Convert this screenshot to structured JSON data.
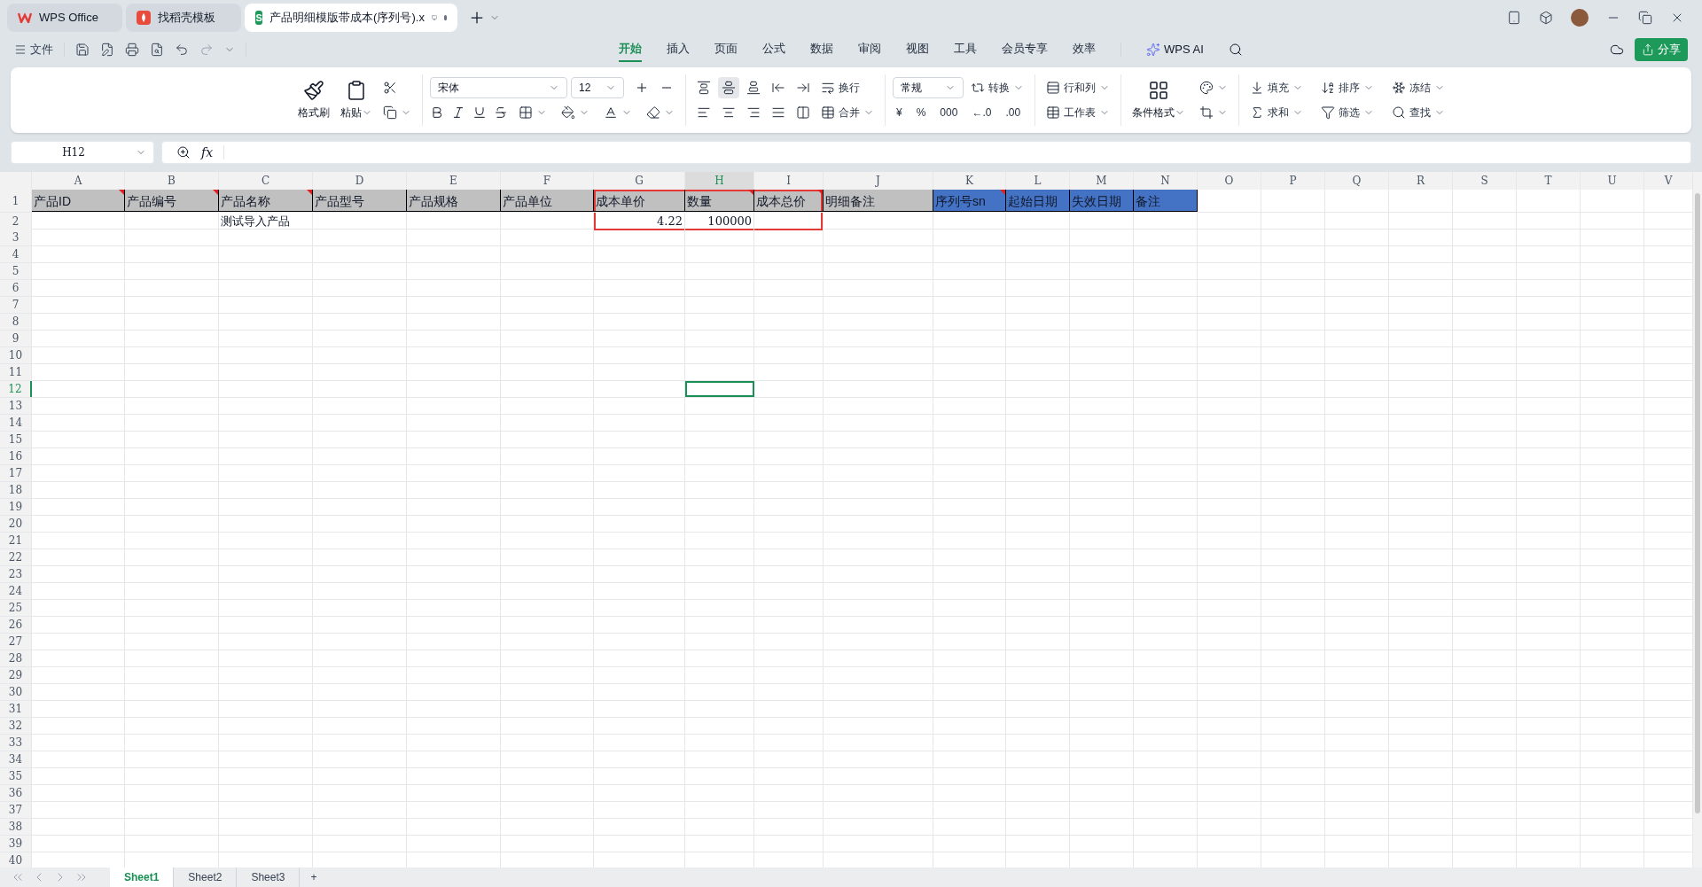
{
  "window_tabs": [
    {
      "kind": "wps",
      "label": "WPS Office",
      "selected": false
    },
    {
      "kind": "template",
      "label": "找稻壳模板",
      "selected": false
    },
    {
      "kind": "sheet",
      "badge": "S",
      "label": "产品明细模版带成本(序列号).x",
      "selected": true
    }
  ],
  "file_menu": "文件",
  "menu_tabs": [
    {
      "label": "开始",
      "selected": true
    },
    {
      "label": "插入",
      "selected": false
    },
    {
      "label": "页面",
      "selected": false
    },
    {
      "label": "公式",
      "selected": false
    },
    {
      "label": "数据",
      "selected": false
    },
    {
      "label": "审阅",
      "selected": false
    },
    {
      "label": "视图",
      "selected": false
    },
    {
      "label": "工具",
      "selected": false
    },
    {
      "label": "会员专享",
      "selected": false
    },
    {
      "label": "效率",
      "selected": false
    }
  ],
  "ai_label": "WPS AI",
  "share_label": "分享",
  "ribbon": {
    "format_painter": "格式刷",
    "paste": "粘贴",
    "font": "宋体",
    "size": "12",
    "wrap": "换行",
    "merge": "合并",
    "number_format": "常规",
    "convert": "转换",
    "currency": "¥",
    "percent": "%",
    "thousands": "000",
    "dec_more": "←.0",
    "dec_less": ".00",
    "rows_cols": "行和列",
    "worksheet": "工作表",
    "conditional": "条件格式",
    "fill": "填充",
    "sort": "排序",
    "freeze": "冻结",
    "sum": "求和",
    "filter": "筛选",
    "find": "查找"
  },
  "align_buttons": [
    {
      "selected": false
    },
    {
      "selected": true
    },
    {
      "selected": false
    },
    {
      "selected": false
    },
    {
      "selected": false
    }
  ],
  "name_box": "H12",
  "formula_label": "fx",
  "columns": [
    {
      "label": "A",
      "selected": false
    },
    {
      "label": "B",
      "selected": false
    },
    {
      "label": "C",
      "selected": false
    },
    {
      "label": "D",
      "selected": false
    },
    {
      "label": "E",
      "selected": false
    },
    {
      "label": "F",
      "selected": false
    },
    {
      "label": "G",
      "selected": false
    },
    {
      "label": "H",
      "selected": true
    },
    {
      "label": "I",
      "selected": false
    },
    {
      "label": "J",
      "selected": false
    },
    {
      "label": "K",
      "selected": false
    },
    {
      "label": "L",
      "selected": false
    },
    {
      "label": "M",
      "selected": false
    },
    {
      "label": "N",
      "selected": false
    },
    {
      "label": "O",
      "selected": false
    },
    {
      "label": "P",
      "selected": false
    },
    {
      "label": "Q",
      "selected": false
    },
    {
      "label": "R",
      "selected": false
    },
    {
      "label": "S",
      "selected": false
    },
    {
      "label": "T",
      "selected": false
    },
    {
      "label": "U",
      "selected": false
    },
    {
      "label": "V",
      "selected": false
    }
  ],
  "rows": [
    {
      "label": "1",
      "selected": false,
      "cells": [
        {
          "kind": "header",
          "text": "产品ID",
          "color": "#c0c0c0",
          "comment": true,
          "highlighted": false
        },
        {
          "kind": "header",
          "text": "产品编号",
          "color": "#c0c0c0",
          "comment": true,
          "highlighted": false
        },
        {
          "kind": "header",
          "text": "产品名称",
          "color": "#c0c0c0",
          "comment": true,
          "highlighted": false
        },
        {
          "kind": "header",
          "text": "产品型号",
          "color": "#c0c0c0",
          "comment": false,
          "highlighted": false
        },
        {
          "kind": "header",
          "text": "产品规格",
          "color": "#c0c0c0",
          "comment": false,
          "highlighted": false
        },
        {
          "kind": "header",
          "text": "产品单位",
          "color": "#c0c0c0",
          "comment": false,
          "highlighted": false
        },
        {
          "kind": "header",
          "text": "成本单价",
          "color": "#c0c0c0",
          "comment": false,
          "highlighted": true
        },
        {
          "kind": "header",
          "text": "数量",
          "color": "#c0c0c0",
          "comment": true,
          "highlighted": true
        },
        {
          "kind": "header",
          "text": "成本总价",
          "color": "#c0c0c0",
          "comment": true,
          "highlighted": true
        },
        {
          "kind": "header",
          "text": "明细备注",
          "color": "#c0c0c0",
          "comment": false,
          "highlighted": false
        },
        {
          "kind": "header",
          "text": "序列号sn",
          "color": "#4472c4",
          "comment": true,
          "highlighted": false
        },
        {
          "kind": "header",
          "text": "起始日期",
          "color": "#4472c4",
          "comment": false,
          "highlighted": false
        },
        {
          "kind": "header",
          "text": "失效日期",
          "color": "#4472c4",
          "comment": false,
          "highlighted": false
        },
        {
          "kind": "header",
          "text": "备注",
          "color": "#4472c4",
          "comment": false,
          "highlighted": false
        }
      ]
    },
    {
      "label": "2",
      "selected": false,
      "cells": [
        {
          "kind": "empty",
          "highlighted": false
        },
        {
          "kind": "empty",
          "highlighted": false
        },
        {
          "kind": "text",
          "text": "测试导入产品",
          "highlighted": false
        },
        {
          "kind": "empty",
          "highlighted": false
        },
        {
          "kind": "empty",
          "highlighted": false
        },
        {
          "kind": "empty",
          "highlighted": false
        },
        {
          "kind": "number",
          "text": "4.22",
          "highlighted": true
        },
        {
          "kind": "number",
          "text": "100000",
          "highlighted": true
        },
        {
          "kind": "empty",
          "highlighted": true
        }
      ]
    },
    {
      "label": "3",
      "selected": false
    },
    {
      "label": "4",
      "selected": false
    },
    {
      "label": "5",
      "selected": false
    },
    {
      "label": "6",
      "selected": false
    },
    {
      "label": "7",
      "selected": false
    },
    {
      "label": "8",
      "selected": false
    },
    {
      "label": "9",
      "selected": false
    },
    {
      "label": "10",
      "selected": false
    },
    {
      "label": "11",
      "selected": false
    },
    {
      "label": "12",
      "selected": true
    },
    {
      "label": "13",
      "selected": false
    },
    {
      "label": "14",
      "selected": false
    },
    {
      "label": "15",
      "selected": false
    },
    {
      "label": "16",
      "selected": false
    },
    {
      "label": "17",
      "selected": false
    },
    {
      "label": "18",
      "selected": false
    },
    {
      "label": "19",
      "selected": false
    },
    {
      "label": "20",
      "selected": false
    },
    {
      "label": "21",
      "selected": false
    },
    {
      "label": "22",
      "selected": false
    },
    {
      "label": "23",
      "selected": false
    },
    {
      "label": "24",
      "selected": false
    },
    {
      "label": "25",
      "selected": false
    },
    {
      "label": "26",
      "selected": false
    },
    {
      "label": "27",
      "selected": false
    },
    {
      "label": "28",
      "selected": false
    },
    {
      "label": "29",
      "selected": false
    },
    {
      "label": "30",
      "selected": false
    },
    {
      "label": "31",
      "selected": false
    },
    {
      "label": "32",
      "selected": false
    },
    {
      "label": "33",
      "selected": false
    },
    {
      "label": "34",
      "selected": false
    },
    {
      "label": "35",
      "selected": false
    },
    {
      "label": "36",
      "selected": false
    },
    {
      "label": "37",
      "selected": false
    },
    {
      "label": "38",
      "selected": false
    },
    {
      "label": "39",
      "selected": false
    },
    {
      "label": "40",
      "selected": false
    }
  ],
  "sheet_tabs": [
    {
      "label": "Sheet1",
      "selected": true
    },
    {
      "label": "Sheet2",
      "selected": false
    },
    {
      "label": "Sheet3",
      "selected": false
    }
  ],
  "add_sheet": "+"
}
